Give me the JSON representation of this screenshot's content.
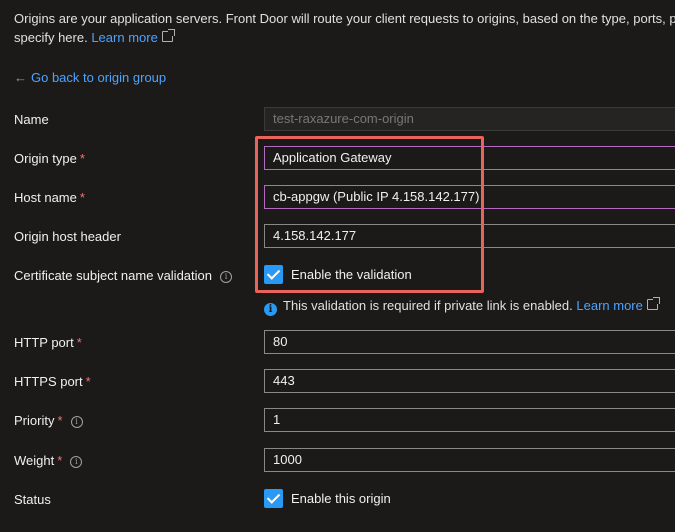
{
  "intro": {
    "line1": "Origins are your application servers. Front Door will route your client requests to origins, based on the type, ports, p",
    "line2": "specify here.",
    "learn_more": "Learn more"
  },
  "back_link": "Go back to origin group",
  "fields": {
    "name": {
      "label": "Name",
      "value": "test-raxazure-com-origin"
    },
    "origin_type": {
      "label": "Origin type",
      "value": "Application Gateway"
    },
    "host_name": {
      "label": "Host name",
      "value": "cb-appgw (Public IP 4.158.142.177)"
    },
    "origin_host_header": {
      "label": "Origin host header",
      "value": "4.158.142.177"
    },
    "cert_validation": {
      "label": "Certificate subject name validation",
      "checkbox_label": "Enable the validation"
    },
    "note": {
      "text": "This validation is required if private link is enabled.",
      "learn_more": "Learn more"
    },
    "http_port": {
      "label": "HTTP port",
      "value": "80"
    },
    "https_port": {
      "label": "HTTPS port",
      "value": "443"
    },
    "priority": {
      "label": "Priority",
      "value": "1"
    },
    "weight": {
      "label": "Weight",
      "value": "1000"
    },
    "status": {
      "label": "Status",
      "checkbox_label": "Enable this origin"
    }
  },
  "required_marker": "*",
  "colors": {
    "accent": "#2899f5",
    "link": "#4da3ff",
    "required": "#f1707b",
    "highlight": "#e8645a"
  }
}
